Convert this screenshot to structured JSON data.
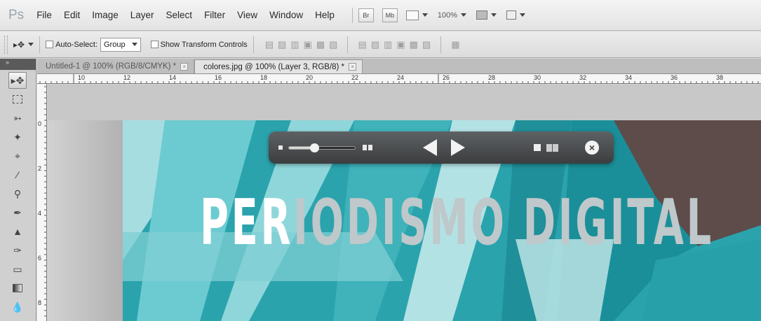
{
  "app": {
    "logo": "Ps"
  },
  "menu": [
    "File",
    "Edit",
    "Image",
    "Layer",
    "Select",
    "Filter",
    "View",
    "Window",
    "Help"
  ],
  "menubar_buttons": {
    "bridge": "Br",
    "mini_bridge": "Mb",
    "zoom": "100%"
  },
  "options_bar": {
    "auto_select_label": "Auto-Select:",
    "auto_select_value": "Group",
    "show_transform_label": "Show Transform Controls"
  },
  "tabs": [
    {
      "label": "Untitled-1 @ 100% (RGB/8/CMYK) *",
      "close": "×"
    },
    {
      "label": "colores.jpg @ 100% (Layer 3, RGB/8) *",
      "close": "×"
    }
  ],
  "ruler": {
    "horizontal": [
      "10",
      "12",
      "14",
      "16",
      "18",
      "20",
      "22",
      "24",
      "26",
      "28",
      "30",
      "32",
      "34",
      "36",
      "38"
    ],
    "vertical": [
      "0",
      "2",
      "4",
      "6",
      "8"
    ]
  },
  "canvas": {
    "headline_white": "PER",
    "headline_rest": "IODISMO DIGITAL"
  },
  "hud": {
    "close": "×",
    "zoom_fraction": 0.38
  },
  "colors": {
    "image_teal": "#2aa3ad",
    "hud_bg": "#444749"
  },
  "icons": [
    "move-tool-icon",
    "marquee-icon",
    "lasso-icon",
    "quick-select-icon",
    "crop-icon",
    "eyedropper-icon",
    "healing-icon",
    "brush-icon",
    "stamp-icon",
    "history-brush-icon",
    "eraser-icon",
    "gradient-icon",
    "blur-icon"
  ]
}
